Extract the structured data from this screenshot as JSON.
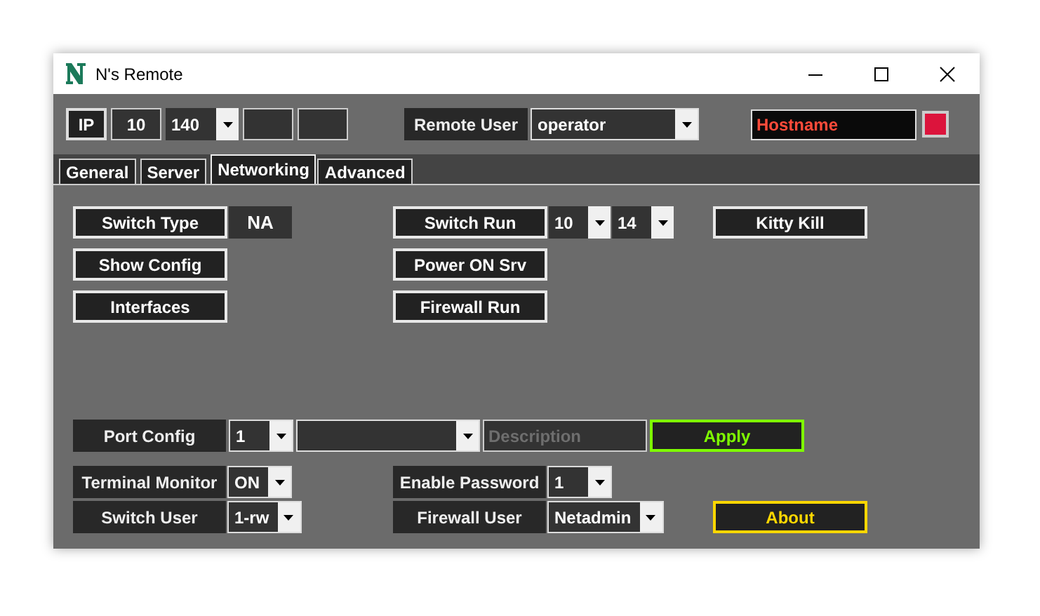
{
  "window": {
    "title": "N's Remote"
  },
  "toolbar": {
    "ip_label": "IP",
    "ip_octets": [
      {
        "kind": "field",
        "value": "10"
      },
      {
        "kind": "combo",
        "value": "140"
      },
      {
        "kind": "field"
      },
      {
        "kind": "field"
      }
    ],
    "remote_user": {
      "label": "Remote User",
      "value": "operator"
    },
    "hostname": {
      "value": "Hostname"
    },
    "status_indicator": {
      "color": "#dc143c"
    }
  },
  "tabs": [
    {
      "label": "General",
      "selected": false
    },
    {
      "label": "Server",
      "selected": false
    },
    {
      "label": "Networking",
      "selected": true
    },
    {
      "label": "Advanced",
      "selected": false
    }
  ],
  "action_rows": [
    {
      "left": [
        {
          "kind": "button",
          "label": "Switch Type"
        },
        {
          "kind": "value",
          "value": "NA"
        }
      ],
      "middle": [
        {
          "kind": "button",
          "label": "Switch Run"
        },
        {
          "kind": "combo",
          "value": "10",
          "bordered": false
        },
        {
          "kind": "combo",
          "value": "14",
          "bordered": false
        }
      ],
      "right": [
        {
          "kind": "button",
          "label": "Kitty Kill"
        }
      ]
    },
    {
      "left": [
        {
          "kind": "button",
          "label": "Show Config"
        }
      ],
      "middle": [
        {
          "kind": "button",
          "label": "Power ON Srv"
        }
      ]
    },
    {
      "left": [
        {
          "kind": "button",
          "label": "Interfaces"
        }
      ],
      "middle": [
        {
          "kind": "button",
          "label": "Firewall Run"
        }
      ]
    }
  ],
  "port_config": [
    {
      "kind": "label",
      "label": "Port Config"
    },
    {
      "kind": "combo",
      "value": "1",
      "bordered": true
    },
    {
      "kind": "combo",
      "bordered": true
    },
    {
      "kind": "field",
      "placeholder": "Description"
    },
    {
      "kind": "button",
      "label": "Apply",
      "color": "#7fff00"
    }
  ],
  "settings_rows": [
    {
      "left": [
        {
          "kind": "label",
          "label": "Terminal Monitor"
        },
        {
          "kind": "combo",
          "value": "ON",
          "bordered": true
        }
      ],
      "middle": [
        {
          "kind": "label",
          "label": "Enable Password"
        },
        {
          "kind": "combo",
          "value": "1",
          "bordered": true
        }
      ]
    },
    {
      "left": [
        {
          "kind": "label",
          "label": "Switch User"
        },
        {
          "kind": "combo",
          "value": "1-rw",
          "bordered": true
        }
      ],
      "middle": [
        {
          "kind": "label",
          "label": "Firewall User"
        },
        {
          "kind": "combo",
          "value": "Netadmin",
          "bordered": true
        }
      ],
      "right": [
        {
          "kind": "button",
          "label": "About",
          "color": "#ffd700"
        }
      ]
    }
  ]
}
